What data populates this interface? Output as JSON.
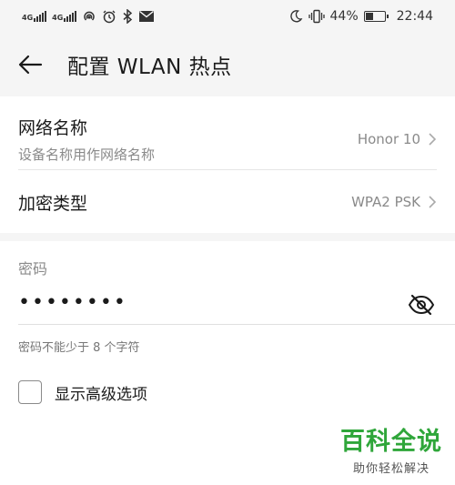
{
  "statusbar": {
    "sim1": "4G",
    "sim2": "4G",
    "battery_pct": "44%",
    "battery_level": 0.44,
    "time": "22:44",
    "icons_left": [
      "signal-icon",
      "signal-icon",
      "hotspot-icon",
      "alarm-icon",
      "bluetooth-icon",
      "mail-icon"
    ],
    "icons_right": [
      "moon-icon",
      "vibrate-icon",
      "battery-icon"
    ]
  },
  "header": {
    "title": "配置 WLAN 热点"
  },
  "network_name": {
    "label": "网络名称",
    "sublabel": "设备名称用作网络名称",
    "value": "Honor 10"
  },
  "encryption": {
    "label": "加密类型",
    "value": "WPA2 PSK"
  },
  "password": {
    "label": "密码",
    "value": "••••••••",
    "hint": "密码不能少于 8 个字符"
  },
  "advanced": {
    "label": "显示高级选项",
    "checked": false
  },
  "watermark": {
    "title": "百科全说",
    "subtitle": "助你轻松解决"
  }
}
